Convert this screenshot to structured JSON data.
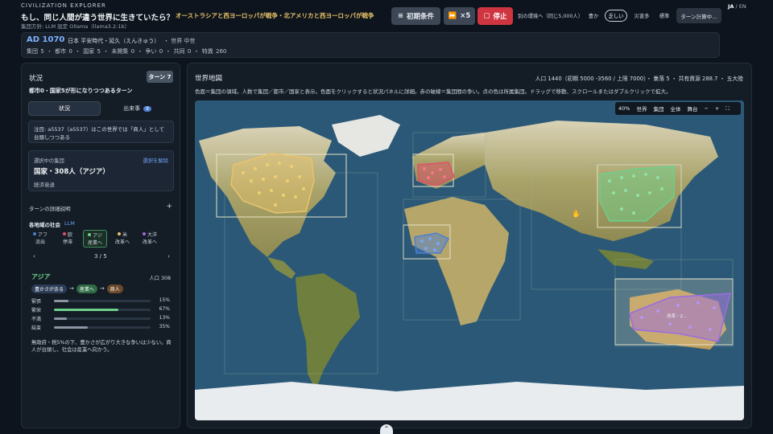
{
  "header": {
    "app_name": "CIVILIZATION EXPLORER",
    "title": "もし、同じ人間が違う世界に生きていたら？",
    "subtitle": "集団方針: LLM 設定 Ollama（llama3.2:1b）",
    "war_banner": "オーストラシアと西ヨーロッパが戦争・北アメリカと西ヨーロッパが戦争",
    "buttons": {
      "initial": "初期条件",
      "speed": "×5",
      "stop": "停止"
    },
    "env_label": "別の環境へ（同じ5,000人）",
    "chips": [
      "豊か",
      "乏しい",
      "災害多",
      "標準"
    ],
    "turn_calc": "ターン計算中…",
    "lang_ja": "JA",
    "lang_sep": "/",
    "lang_en": "EN"
  },
  "stats": {
    "year": "AD 1070",
    "era": "日本 平安時代・延久（えんきゅう）",
    "world_era": "・ 世界 中世",
    "counts": "集団 5 ・ 都市 0 ・ 国家 5 ・ 未開集 0 ・ 争い 0 ・ 共同 0 ・ 特異 260"
  },
  "left": {
    "title": "状況",
    "turn_badge": "ターン 7",
    "headline": "都市0・国家5が形になりつつあるターン",
    "tabs": {
      "status": "状況",
      "events": "出来事",
      "events_count": "9"
    },
    "notice": "注目: a5537（a5537）はこの世界では「商人」として台頭しつつある",
    "selected": {
      "label": "選択中の集団",
      "clear": "選択を解除",
      "name": "国家・308人（アジア）",
      "state": "経済衰退"
    },
    "details_heading": "ターンの詳細説明",
    "details_toggle": "+",
    "society_heading": "各地域の社会",
    "society_llm": "LLM",
    "regions": [
      {
        "name": "アフ",
        "state": "流出",
        "color": "#4d7ed0"
      },
      {
        "name": "欧",
        "state": "停滞",
        "color": "#e0506a"
      },
      {
        "name": "アジ",
        "state": "産業へ",
        "color": "#6cd08a"
      },
      {
        "name": "米",
        "state": "改革へ",
        "color": "#e9c36a"
      },
      {
        "name": "大洋",
        "state": "改革へ",
        "color": "#9a6ce0"
      }
    ],
    "pager": {
      "prev": "‹",
      "text": "3 / 5",
      "next": "›"
    },
    "asia": {
      "name": "アジア",
      "population": "人口 308",
      "flow": [
        "豊かさが余る",
        "産業へ",
        "商人"
      ],
      "arrow": "→",
      "bars": [
        {
          "label": "緊張",
          "value": 15,
          "pct": "15%"
        },
        {
          "label": "繁栄",
          "value": 67,
          "pct": "67%"
        },
        {
          "label": "不満",
          "value": 13,
          "pct": "13%"
        },
        {
          "label": "結束",
          "value": 35,
          "pct": "35%"
        }
      ],
      "summary": "無政府・税5%の下、豊かさが広がり大きな争いは少ない。商人が台頭し、社会は産業へ向かう。"
    }
  },
  "map": {
    "title": "世界地図",
    "stats": "人口 1440（初期 5000 -3560 / 上限 7000）・ 集落 5 ・ 共有資源 288.7 ・ 五大陸",
    "description": "色面＝集団の領域。人数で集団／都市／国家と表示。色面をクリックすると状況パネルに詳細。赤の破線＝集団間の争い。点の色は所属集団。ドラッグで移動、スクロールまたはダブルクリックで拡大。",
    "toolbar": [
      "40%",
      "世界",
      "集団",
      "全体",
      "舞台",
      "−",
      "+",
      "⛶"
    ],
    "label_oceania": "改革・2…"
  },
  "colors": {
    "accent_blue": "#7fb2ff",
    "stop_red": "#cf3540",
    "war_gold": "#e9c36a",
    "asia_green": "#6cd08a"
  }
}
